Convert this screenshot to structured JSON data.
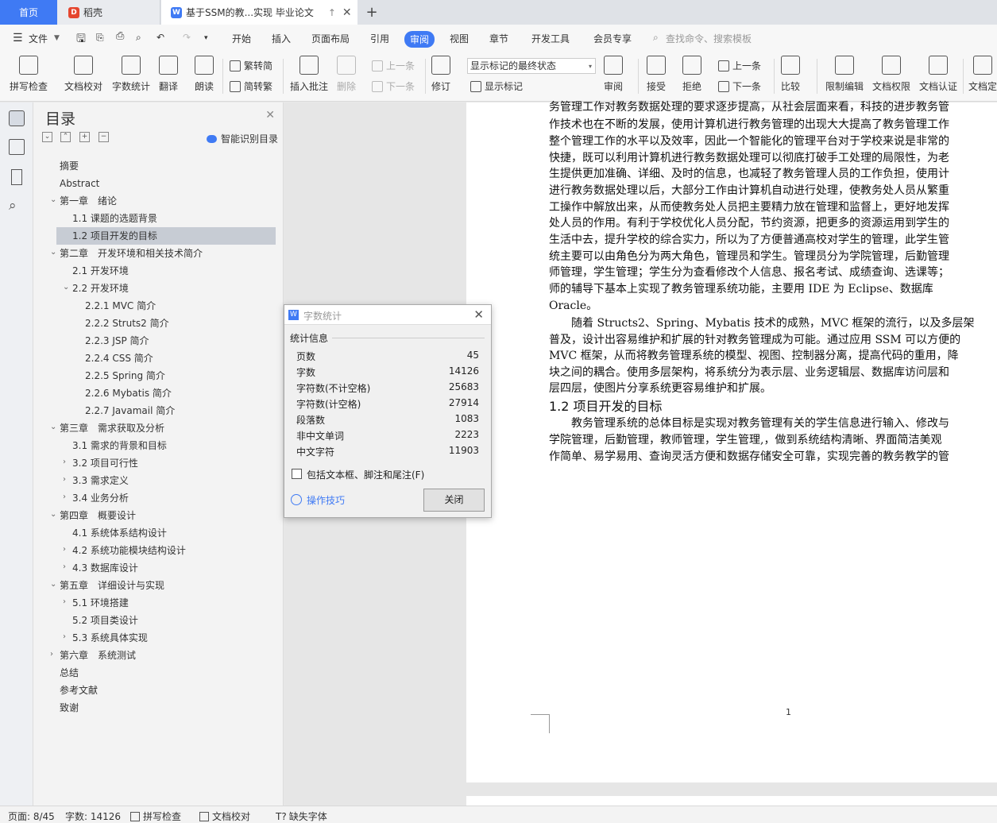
{
  "tabs": {
    "home": "首页",
    "daoke": "稻壳",
    "doc": "基于SSM的教...实现 毕业论文"
  },
  "menu": {
    "file": "文件",
    "items": [
      "开始",
      "插入",
      "页面布局",
      "引用",
      "审阅",
      "视图",
      "章节",
      "开发工具",
      "会员专享"
    ],
    "search": "查找命令、搜索模板"
  },
  "ribbon": {
    "spellcheck": "拼写检查",
    "doc_proof": "文档校对",
    "word_count": "字数统计",
    "translate": "翻译",
    "read": "朗读",
    "to_traditional": "繁转简",
    "to_simplified": "简转繁",
    "insert_comment": "插入批注",
    "delete": "删除",
    "prev": "上一条",
    "next": "下一条",
    "revise": "修订",
    "track_mode": "显示标记的最终状态",
    "show_markup": "显示标记",
    "review": "审阅",
    "accept": "接受",
    "reject": "拒绝",
    "prev2": "上一条",
    "next2": "下一条",
    "compare": "比较",
    "restrict_edit": "限制编辑",
    "doc_perm": "文档权限",
    "doc_auth": "文档认证",
    "doc_final": "文档定"
  },
  "toc": {
    "title": "目录",
    "smart": "智能识别目录",
    "items": [
      "摘要",
      "Abstract",
      "第一章　绪论",
      "1.1  课题的选题背景",
      "1.2  项目开发的目标",
      "第二章　开发环境和相关技术简介",
      "2.1  开发环境",
      "2.2  开发环境",
      "2.2.1 MVC 简介",
      "2.2.2 Struts2 简介",
      "2.2.3 JSP 简介",
      "2.2.4 CSS 简介",
      "2.2.5 Spring 简介",
      "2.2.6 Mybatis 简介",
      "2.2.7 Javamail 简介",
      "第三章　需求获取及分析",
      "3.1  需求的背景和目标",
      "3.2  项目可行性",
      "3.3  需求定义",
      "3.4  业务分析",
      "第四章　概要设计",
      "4.1  系统体系结构设计",
      "4.2  系统功能模块结构设计",
      "4.3  数据库设计",
      "第五章　详细设计与实现",
      "5.1  环境搭建",
      "5.2  项目类设计",
      "5.3  系统具体实现",
      "第六章　系统测试",
      "总结",
      "参考文献",
      "致谢"
    ]
  },
  "doc": {
    "lines": [
      "务管理工作对教务数据处理的要求逐步提高，从社会层面来看，科技的进步教务管",
      "作技术也在不断的发展，使用计算机进行教务管理的出现大大提高了教务管理工作",
      "整个管理工作的水平以及效率，因此一个智能化的管理平台对于学校来说是非常的",
      "快捷，既可以利用计算机进行教务数据处理可以彻底打破手工处理的局限性，为老",
      "生提供更加准确、详细、及时的信息，也减轻了教务管理人员的工作负担，使用计",
      "进行教务数据处理以后，大部分工作由计算机自动进行处理，使教务处人员从繁重",
      "工操作中解放出来，从而使教务处人员把主要精力放在管理和监督上，更好地发挥",
      "处人员的作用。有利于学校优化人员分配，节约资源，把更多的资源运用到学生的",
      "生活中去，提升学校的综合实力，所以为了方便普通高校对学生的管理，此学生管",
      "统主要可以由角色分为两大角色，管理员和学生。管理员分为学院管理，后勤管理",
      "师管理，学生管理；学生分为查看修改个人信息、报名考试、成绩查询、选课等；",
      "师的辅导下基本上实现了教务管理系统功能，主要用 IDE 为 Eclipse、数据库",
      "Oracle。",
      "　　随着 Structs2、Spring、Mybatis 技术的成熟，MVC 框架的流行，以及多层架",
      "普及，设计出容易维护和扩展的针对教务管理成为可能。通过应用 SSM 可以方便的",
      "MVC 框架，从而将教务管理系统的模型、视图、控制器分离，提高代码的重用，降",
      "块之间的耦合。使用多层架构，将系统分为表示层、业务逻辑层、数据库访问层和",
      "层四层，使图片分享系统更容易维护和扩展。"
    ],
    "heading": "1.2  项目开发的目标",
    "lines2": [
      "　　教务管理系统的总体目标是实现对教务管理有关的学生信息进行输入、修改与",
      "学院管理，后勤管理，教师管理，学生管理,，做到系统结构清晰、界面简洁美观",
      "作简单、易学易用、查询灵活方便和数据存储安全可靠，实现完善的教务教学的管"
    ],
    "page_number": "1"
  },
  "dialog": {
    "title": "字数统计",
    "section": "统计信息",
    "rows": [
      {
        "label": "页数",
        "value": "45"
      },
      {
        "label": "字数",
        "value": "14126"
      },
      {
        "label": "字符数(不计空格)",
        "value": "25683"
      },
      {
        "label": "字符数(计空格)",
        "value": "27914"
      },
      {
        "label": "段落数",
        "value": "1083"
      },
      {
        "label": "非中文单词",
        "value": "2223"
      },
      {
        "label": "中文字符",
        "value": "11903"
      }
    ],
    "checkbox": "包括文本框、脚注和尾注(F)",
    "tips": "操作技巧",
    "close": "关闭"
  },
  "status": {
    "page": "页面: 8/45",
    "words": "字数: 14126",
    "spell": "拼写检查",
    "proof": "文档校对",
    "font": "缺失字体"
  },
  "colors": {
    "accent": "#3f7af4"
  }
}
